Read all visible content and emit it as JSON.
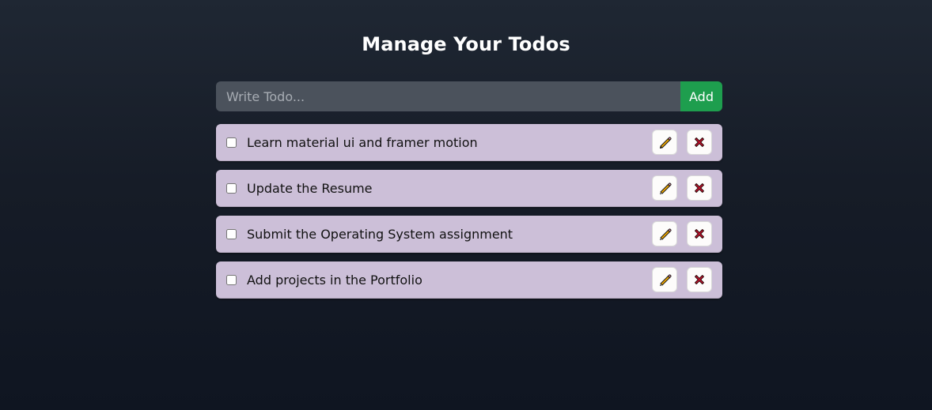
{
  "header": {
    "title": "Manage Your Todos"
  },
  "add_form": {
    "placeholder": "Write Todo...",
    "value": "",
    "add_label": "Add"
  },
  "todos": [
    {
      "text": "Learn material ui and framer motion",
      "completed": false
    },
    {
      "text": "Update the Resume",
      "completed": false
    },
    {
      "text": "Submit the Operating System assignment",
      "completed": false
    },
    {
      "text": "Add projects in the Portfolio",
      "completed": false
    }
  ],
  "icons": {
    "edit": "pencil-icon",
    "delete": "cross-mark-icon"
  },
  "colors": {
    "background_top": "#1f2733",
    "background_bottom": "#0f1521",
    "input_bg": "#4b525c",
    "add_button": "#1e9e4e",
    "todo_card": "#ccbfd8",
    "delete_icon": "#c8102e",
    "edit_icon": "#f2a900"
  }
}
